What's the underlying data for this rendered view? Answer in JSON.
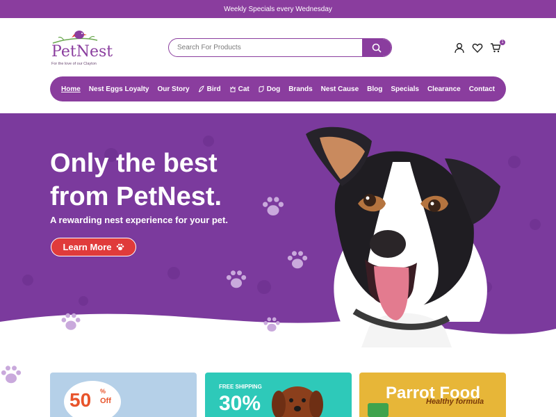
{
  "announcement": "Weekly Specials every Wednesday",
  "logo": {
    "name_part1": "Pet",
    "name_part2": "Nest",
    "tagline": "For the love of our Clayton"
  },
  "search": {
    "placeholder": "Search For Products"
  },
  "header_icons": {
    "account": "user-icon",
    "wishlist": "heart-icon",
    "cart": "cart-icon",
    "cart_count": "1"
  },
  "nav": [
    {
      "label": "Home",
      "icon": ""
    },
    {
      "label": "Nest Eggs Loyalty",
      "icon": ""
    },
    {
      "label": "Our Story",
      "icon": ""
    },
    {
      "label": "Bird",
      "icon": "bird-icon"
    },
    {
      "label": "Cat",
      "icon": "cat-icon"
    },
    {
      "label": "Dog",
      "icon": "dog-icon"
    },
    {
      "label": "Brands",
      "icon": ""
    },
    {
      "label": "Nest Cause",
      "icon": ""
    },
    {
      "label": "Blog",
      "icon": ""
    },
    {
      "label": "Specials",
      "icon": ""
    },
    {
      "label": "Clearance",
      "icon": ""
    },
    {
      "label": "Contact",
      "icon": ""
    }
  ],
  "hero": {
    "title": "Only the best from PetNest.",
    "subtitle": "A rewarding nest experience for your pet.",
    "button": "Learn More"
  },
  "promos": [
    {
      "pct": "50",
      "sym": "%",
      "off": "Off"
    },
    {
      "note": "FREE SHIPPING",
      "pct": "30%"
    },
    {
      "title": "Parrot Food",
      "subtitle": "Healthy formula"
    }
  ],
  "colors": {
    "brand": "#8a3d9e",
    "button": "#e03b3b",
    "hero": "#7b3a9d"
  }
}
